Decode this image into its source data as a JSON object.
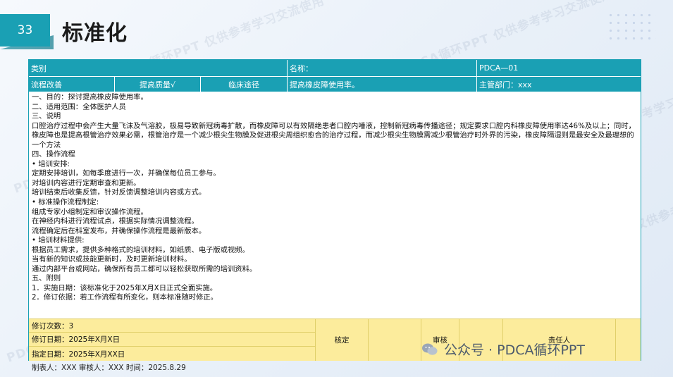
{
  "page": {
    "number": "33",
    "title": "标准化"
  },
  "watermark": "PDCA循环PPT 仅供参考学习交流使用",
  "header": {
    "category_label": "类别",
    "name_label": "名称：",
    "code": "PDCA—01",
    "types": [
      "流程改善",
      "提高质量√",
      "临床途径"
    ],
    "name_value": "提高橡皮障使用率。",
    "dept": "主管部门：xxx"
  },
  "body": {
    "lines": [
      "一、目的：探讨提高橡皮障使用率。",
      "二、适用范围：全体医护人员",
      "三、说明",
      "口腔治疗过程中会产生大量飞沫及气溶胶，极易导致新冠病毒扩散，而橡皮障可以有效隔绝患者口腔内唾液，控制新冠病毒传播途径；规定要求口腔内科橡皮障使用率达46%及以上；同时，橡皮障也是提高根管治疗效果必需，根管治疗是一个减少根尖生物膜及促进根尖周组织愈合的治疗过程，而减少根尖生物膜需减少根管治疗时外界的污染，橡皮障隔湿则是最安全及最理想的一个方法",
      "四、操作流程",
      "•  培训安排:",
      "定期安排培训，如每季度进行一次，并确保每位员工参与。",
      "对培训内容进行定期审查和更新。",
      "培训结束后收集反馈，针对反馈调整培训内容或方式。",
      "•  标准操作流程制定:",
      "组成专家小组制定和审议操作流程。",
      "在神经内科进行流程试点，根据实际情况调整流程。",
      "流程确定后在科室发布，并确保操作流程是最新版本。",
      "•  培训材料提供:",
      "根据员工需求，提供多种格式的培训材料，如纸质、电子版或视频。",
      "当有新的知识或技能更新时，及时更新培训材料。",
      "通过内部平台或网站，确保所有员工都可以轻松获取所需的培训资料。",
      "五、附则",
      "1．实施日期：该标准化于2025年X月X日正式全面实施。",
      "2．修订依据：若工作流程有所变化，则本标准随时修正。"
    ]
  },
  "footer": {
    "revision_count": "修订次数：3",
    "revision_date": "修订日期：2025年X月X日",
    "designated_date": "指定日期：2025年X月XX日",
    "approve": "核定",
    "review": "审核",
    "responsible": "责任人"
  },
  "makers": "制表人：XXX   审核人：XXX  时间：2025.8.29",
  "wechat": "公众号 · PDCA循环PPT",
  "colors": {
    "accent": "#1aa0b4",
    "footer_bg": "#fcec9c"
  }
}
